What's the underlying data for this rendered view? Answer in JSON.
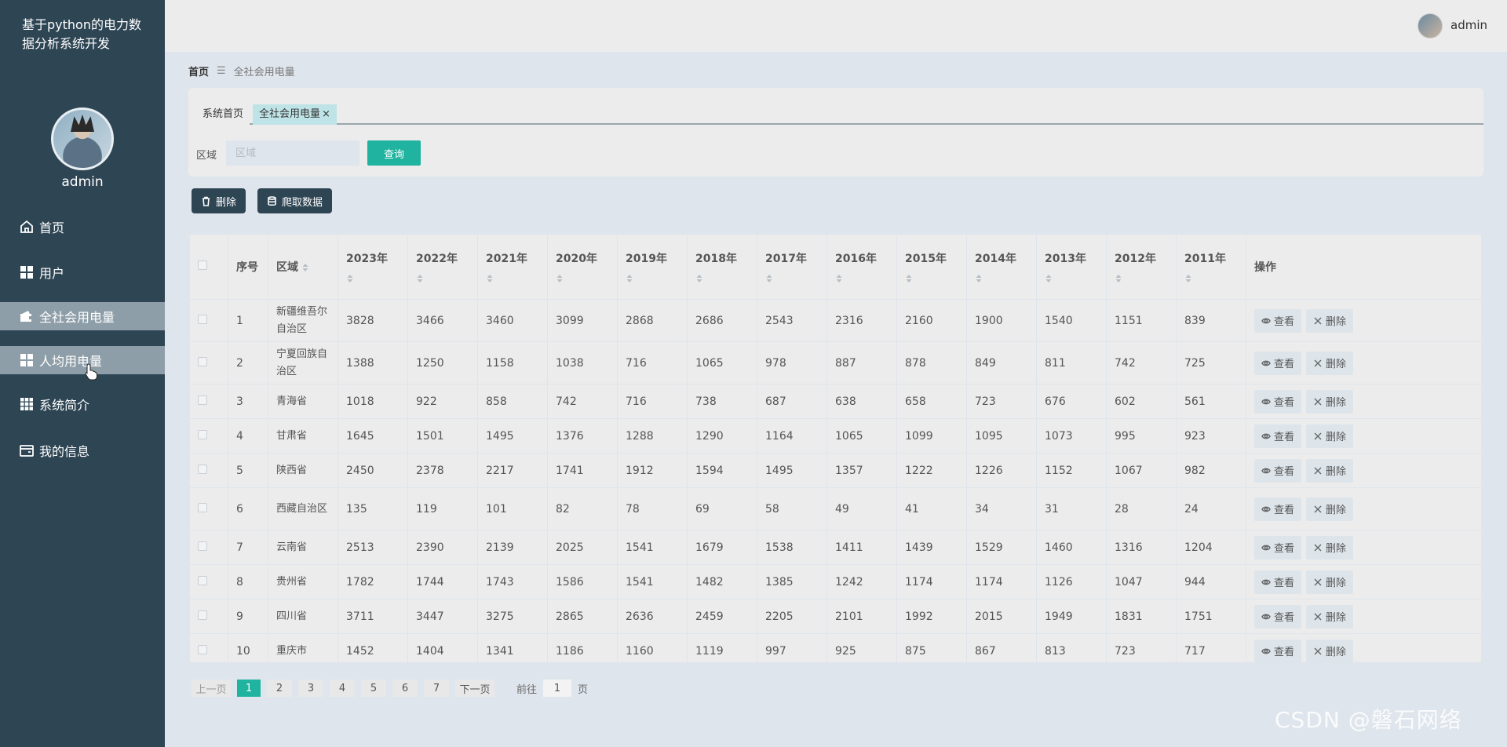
{
  "app": {
    "title": "基于python的电力数据分析系统开发",
    "user": "admin"
  },
  "sidebar": {
    "user": "admin",
    "items": [
      {
        "label": "首页",
        "icon": "home-icon"
      },
      {
        "label": "用户",
        "icon": "grid-icon"
      },
      {
        "label": "全社会用电量",
        "icon": "wallet-icon",
        "active": true
      },
      {
        "label": "人均用电量",
        "icon": "grid-icon",
        "active": true
      },
      {
        "label": "系统简介",
        "icon": "apps-icon"
      },
      {
        "label": "我的信息",
        "icon": "card-icon"
      }
    ]
  },
  "breadcrumb": {
    "home": "首页",
    "separator": "☰",
    "current": "全社会用电量"
  },
  "tabs": [
    {
      "label": "系统首页"
    },
    {
      "label": "全社会用电量",
      "close": "×"
    }
  ],
  "search": {
    "label": "区域",
    "placeholder": "区域",
    "button": "查询"
  },
  "actions": {
    "delete": "删除",
    "crawl": "爬取数据"
  },
  "table": {
    "headers": {
      "index": "序号",
      "region": "区域",
      "years": [
        "2023年",
        "2022年",
        "2021年",
        "2020年",
        "2019年",
        "2018年",
        "2017年",
        "2016年",
        "2015年",
        "2014年",
        "2013年",
        "2012年",
        "2011年"
      ],
      "ops": "操作"
    },
    "op_view": "查看",
    "op_delete": "删除",
    "rows": [
      {
        "no": "1",
        "region": "新疆维吾尔自治区",
        "values": [
          "3828",
          "3466",
          "3460",
          "3099",
          "2868",
          "2686",
          "2543",
          "2316",
          "2160",
          "1900",
          "1540",
          "1151",
          "839"
        ]
      },
      {
        "no": "2",
        "region": "宁夏回族自治区",
        "values": [
          "1388",
          "1250",
          "1158",
          "1038",
          "716",
          "1065",
          "978",
          "887",
          "878",
          "849",
          "811",
          "742",
          "725"
        ]
      },
      {
        "no": "3",
        "region": "青海省",
        "values": [
          "1018",
          "922",
          "858",
          "742",
          "716",
          "738",
          "687",
          "638",
          "658",
          "723",
          "676",
          "602",
          "561"
        ]
      },
      {
        "no": "4",
        "region": "甘肃省",
        "values": [
          "1645",
          "1501",
          "1495",
          "1376",
          "1288",
          "1290",
          "1164",
          "1065",
          "1099",
          "1095",
          "1073",
          "995",
          "923"
        ]
      },
      {
        "no": "5",
        "region": "陕西省",
        "values": [
          "2450",
          "2378",
          "2217",
          "1741",
          "1912",
          "1594",
          "1495",
          "1357",
          "1222",
          "1226",
          "1152",
          "1067",
          "982"
        ]
      },
      {
        "no": "6",
        "region": "西藏自治区",
        "values": [
          "135",
          "119",
          "101",
          "82",
          "78",
          "69",
          "58",
          "49",
          "41",
          "34",
          "31",
          "28",
          "24"
        ]
      },
      {
        "no": "7",
        "region": "云南省",
        "values": [
          "2513",
          "2390",
          "2139",
          "2025",
          "1541",
          "1679",
          "1538",
          "1411",
          "1439",
          "1529",
          "1460",
          "1316",
          "1204"
        ]
      },
      {
        "no": "8",
        "region": "贵州省",
        "values": [
          "1782",
          "1744",
          "1743",
          "1586",
          "1541",
          "1482",
          "1385",
          "1242",
          "1174",
          "1174",
          "1126",
          "1047",
          "944"
        ]
      },
      {
        "no": "9",
        "region": "四川省",
        "values": [
          "3711",
          "3447",
          "3275",
          "2865",
          "2636",
          "2459",
          "2205",
          "2101",
          "1992",
          "2015",
          "1949",
          "1831",
          "1751"
        ]
      },
      {
        "no": "10",
        "region": "重庆市",
        "values": [
          "1452",
          "1404",
          "1341",
          "1186",
          "1160",
          "1119",
          "997",
          "925",
          "875",
          "867",
          "813",
          "723",
          "717"
        ]
      }
    ]
  },
  "pagination": {
    "prev": "上一页",
    "next": "下一页",
    "pages": [
      "1",
      "2",
      "3",
      "4",
      "5",
      "6",
      "7"
    ],
    "current": "1",
    "goto_label": "前往",
    "goto_value": "1",
    "page_unit": "页"
  },
  "watermark": "CSDN @磐石网络"
}
